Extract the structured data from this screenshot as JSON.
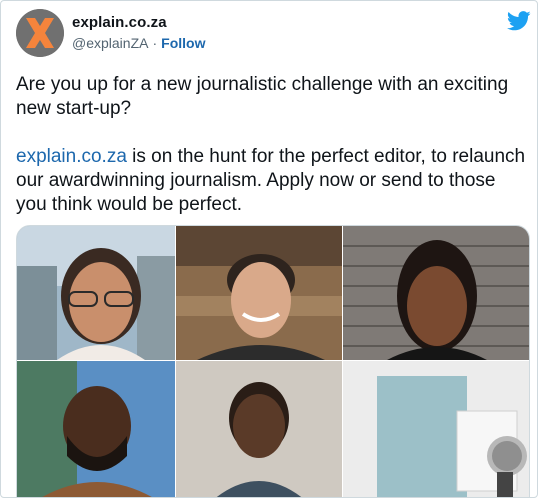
{
  "tweet": {
    "author_name": "explain.co.za",
    "handle": "@explainZA",
    "separator": "·",
    "follow_label": "Follow",
    "text_paragraph1": "Are you up for a new journalistic challenge with an exciting new start-up?",
    "link_text": "explain.co.za",
    "text_paragraph2_rest": " is on the hunt for the perfect editor, to relaunch our awardwinning journalism. Apply now or send to those you think would be perfect."
  },
  "icons": {
    "avatar": "x-logo-avatar",
    "brand": "twitter-bird-icon"
  },
  "colors": {
    "link": "#1d68ad",
    "twitter_blue": "#1da1f2",
    "avatar_orange": "#f5843c",
    "text": "#0f1419",
    "muted": "#536471"
  },
  "media": {
    "photo_count": 6,
    "layout": "3x2 photo collage"
  }
}
